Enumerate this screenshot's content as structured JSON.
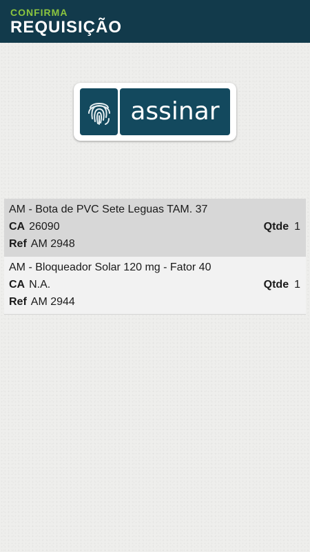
{
  "header": {
    "subtitle": "CONFIRMA",
    "title": "REQUISIÇÃO"
  },
  "sign_button": {
    "label": "assinar",
    "icon": "fingerprint-icon"
  },
  "labels": {
    "ca": "CA",
    "ref": "Ref",
    "qtde": "Qtde"
  },
  "items": [
    {
      "title": "AM - Bota de PVC Sete Leguas TAM. 37",
      "ca": "26090",
      "ref": "AM 2948",
      "qtde": "1"
    },
    {
      "title": "AM - Bloqueador Solar 120 mg - Fator 40",
      "ca": "N.A.",
      "ref": "AM 2944",
      "qtde": "1"
    }
  ],
  "colors": {
    "header_bg": "#123a4b",
    "accent_green": "#8cc63f",
    "button_blue": "#13495e"
  }
}
